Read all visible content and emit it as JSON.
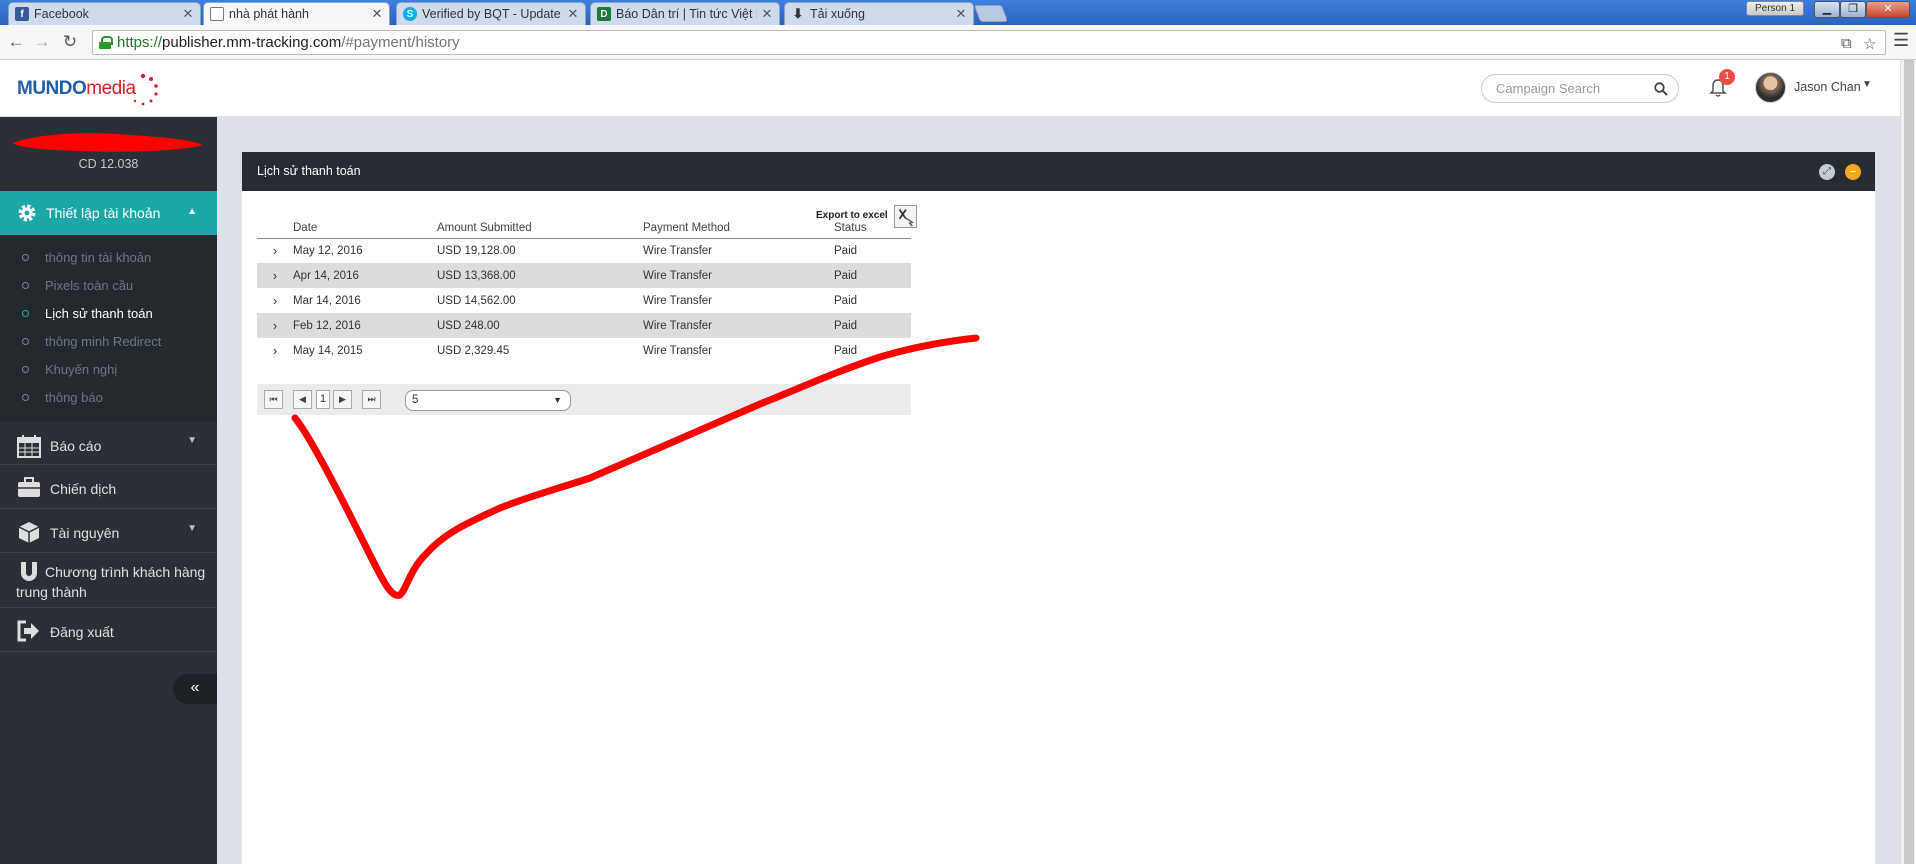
{
  "browser": {
    "tabs": [
      {
        "title": "Facebook",
        "favicon": "facebook-icon",
        "color": "#3b5998",
        "glyph": "f"
      },
      {
        "title": "nhà phát hành",
        "favicon": "page-icon",
        "color": "#ffffff",
        "glyph": ""
      },
      {
        "title": "Verified by BQT - Update",
        "favicon": "skype-icon",
        "color": "#00aff0",
        "glyph": "S"
      },
      {
        "title": "Báo Dân trí | Tin tức Việt N",
        "favicon": "dantri-icon",
        "color": "#1b7a3a",
        "glyph": "D"
      },
      {
        "title": "Tải xuống",
        "favicon": "download-icon",
        "color": "#ffffff",
        "glyph": "⬇"
      }
    ],
    "person": "Person 1",
    "url_scheme": "https://",
    "url_host": "publisher.mm-tracking.com",
    "url_path": "/#payment/history"
  },
  "header": {
    "logo_main": "MUNDO",
    "logo_accent": "media",
    "search_placeholder": "Campaign Search",
    "notification_count": "1",
    "user_name": "Jason Chan"
  },
  "sidebar": {
    "balance": "CD 12.038",
    "active_section": "Thiết lập tài khoản",
    "submenu": [
      {
        "label": "thông tin tài khoản",
        "current": false
      },
      {
        "label": "Pixels toàn cầu",
        "current": false
      },
      {
        "label": "Lịch sử thanh toán",
        "current": true
      },
      {
        "label": "thông minh Redirect",
        "current": false
      },
      {
        "label": "Khuyến nghị",
        "current": false
      },
      {
        "label": "thông báo",
        "current": false
      }
    ],
    "menu": [
      {
        "label": "Báo cáo",
        "icon": "calendar-icon"
      },
      {
        "label": "Chiến dịch",
        "icon": "briefcase-icon"
      },
      {
        "label": "Tài nguyên",
        "icon": "cube-icon"
      },
      {
        "label": "Chương trình khách hàng trung thành",
        "icon": "magnet-icon"
      },
      {
        "label": "Đăng xuất",
        "icon": "logout-icon"
      }
    ]
  },
  "panel": {
    "title": "Lịch sử thanh toán",
    "export_label": "Export to excel",
    "columns": [
      "Date",
      "Amount Submitted",
      "Payment Method",
      "Status"
    ],
    "rows": [
      {
        "date": "May 12, 2016",
        "amount": "USD 19,128.00",
        "method": "Wire Transfer",
        "status": "Paid"
      },
      {
        "date": "Apr 14, 2016",
        "amount": "USD 13,368.00",
        "method": "Wire Transfer",
        "status": "Paid"
      },
      {
        "date": "Mar 14, 2016",
        "amount": "USD 14,562.00",
        "method": "Wire Transfer",
        "status": "Paid"
      },
      {
        "date": "Feb 12, 2016",
        "amount": "USD 248.00",
        "method": "Wire Transfer",
        "status": "Paid"
      },
      {
        "date": "May 14, 2015",
        "amount": "USD 2,329.45",
        "method": "Wire Transfer",
        "status": "Paid"
      }
    ],
    "current_page": "1",
    "page_size": "5"
  },
  "colors": {
    "accent": "#1ba7a7",
    "sidebar": "#2a3036",
    "panel_header": "#262c32",
    "annotation": "#ff0000"
  }
}
